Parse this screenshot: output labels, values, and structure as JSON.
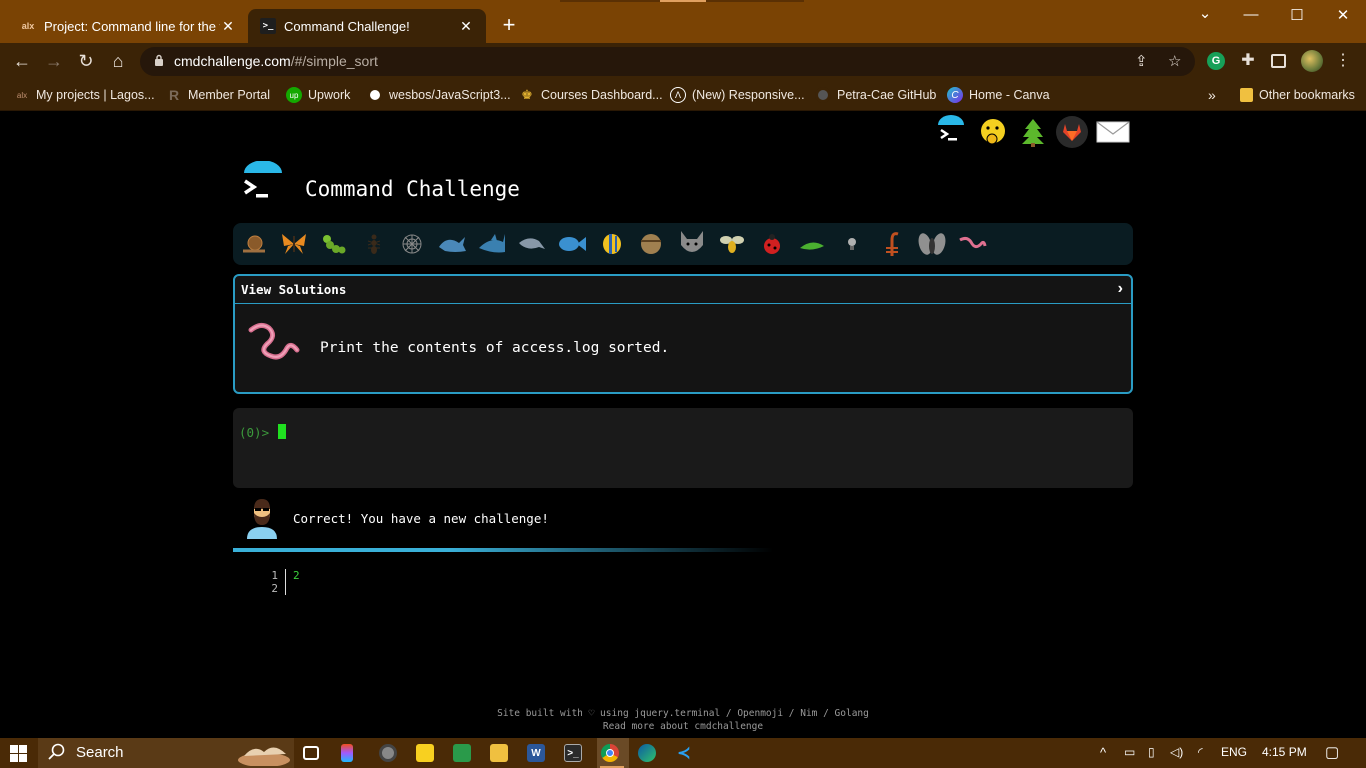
{
  "browser": {
    "tabs": [
      {
        "title": "Project: Command line for the wi",
        "favicon": "alx",
        "active": false
      },
      {
        "title": "Command Challenge!",
        "favicon": ">_",
        "active": true
      }
    ],
    "address": {
      "domain": "cmdchallenge.com",
      "path": "/#/simple_sort"
    },
    "bookmarks": [
      "My projects | Lagos...",
      "Member Portal",
      "Upwork",
      "wesbos/JavaScript3...",
      "Courses Dashboard...",
      "(New) Responsive...",
      "Petra-Cae GitHub",
      "Home - Canva"
    ],
    "bookmarks_more": "»",
    "other_bookmarks": "Other bookmarks",
    "bookmark_icons": {
      "upwork": "up"
    }
  },
  "page": {
    "app_title": "Command Challenge",
    "panel_header": "View Solutions",
    "challenge_text": "Print the contents of access.log sorted.",
    "prompt": "(0)>",
    "feedback": "Correct! You have a new challenge!",
    "output_lines": [
      {
        "num": "1",
        "value": "2"
      },
      {
        "num": "2",
        "value": ""
      }
    ],
    "footer_line1": "Site built with ♡ using jquery.terminal / Openmoji / Nim / Golang",
    "footer_line2": "Read more about cmdchallenge",
    "top_icons": [
      "terminal-icon",
      "face-icon",
      "tree-icon",
      "gitlab-icon",
      "envelope-icon"
    ],
    "levels": [
      "snail",
      "butterfly",
      "caterpillar",
      "ant",
      "spider-web",
      "whale",
      "shark",
      "dolphin",
      "fish",
      "tropical-fish",
      "blowfish",
      "wolf",
      "bee",
      "ladybug",
      "leaf-bug",
      "lightbulb",
      "scorpion",
      "fly",
      "worm"
    ]
  },
  "taskbar": {
    "search_placeholder": "Search",
    "lang": "ENG",
    "time": "4:15 PM",
    "app_labels": {
      "word": "W"
    }
  },
  "colors": {
    "chrome_frame": "#7a4304",
    "chrome_toolbar": "#3b2306",
    "accent_blue": "#2a9cc4",
    "prompt_green": "#3c9a3c",
    "output_green": "#3cd03c"
  }
}
